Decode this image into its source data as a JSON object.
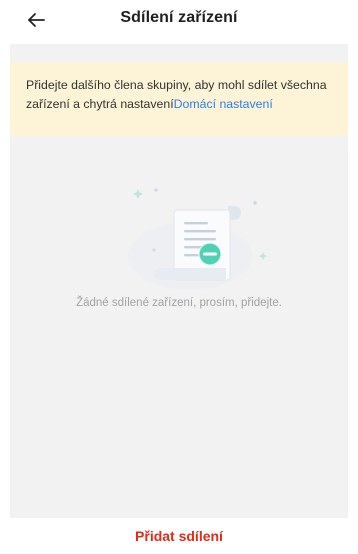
{
  "header": {
    "title": "Sdílení zařízení",
    "back_icon": "arrow-left-icon"
  },
  "notice": {
    "text": "Přidejte dalšího člena skupiny, aby mohl sdílet všechna zařízení a chytrá nastavení",
    "link_label": "Domácí nastavení",
    "background": "#fdf3d6",
    "link_color": "#2b82e4"
  },
  "empty_state": {
    "icon": "empty-document-icon",
    "message": "Žádné sdílené zařízení, prosím, přidejte."
  },
  "footer": {
    "add_button_label": "Přidat sdílení",
    "accent_color": "#e02b1b"
  }
}
